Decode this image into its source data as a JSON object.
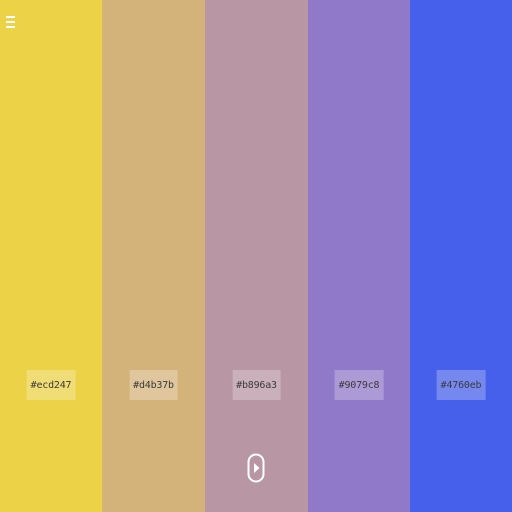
{
  "palette": {
    "colors": [
      {
        "hex": "#ecd247",
        "label": "#ecd247"
      },
      {
        "hex": "#d4b37b",
        "label": "#d4b37b"
      },
      {
        "hex": "#b896a3",
        "label": "#b896a3"
      },
      {
        "hex": "#9079c8",
        "label": "#9079c8"
      },
      {
        "hex": "#4760eb",
        "label": "#4760eb"
      }
    ]
  },
  "icons": {
    "menu": "menu-icon",
    "play": "play-icon"
  }
}
